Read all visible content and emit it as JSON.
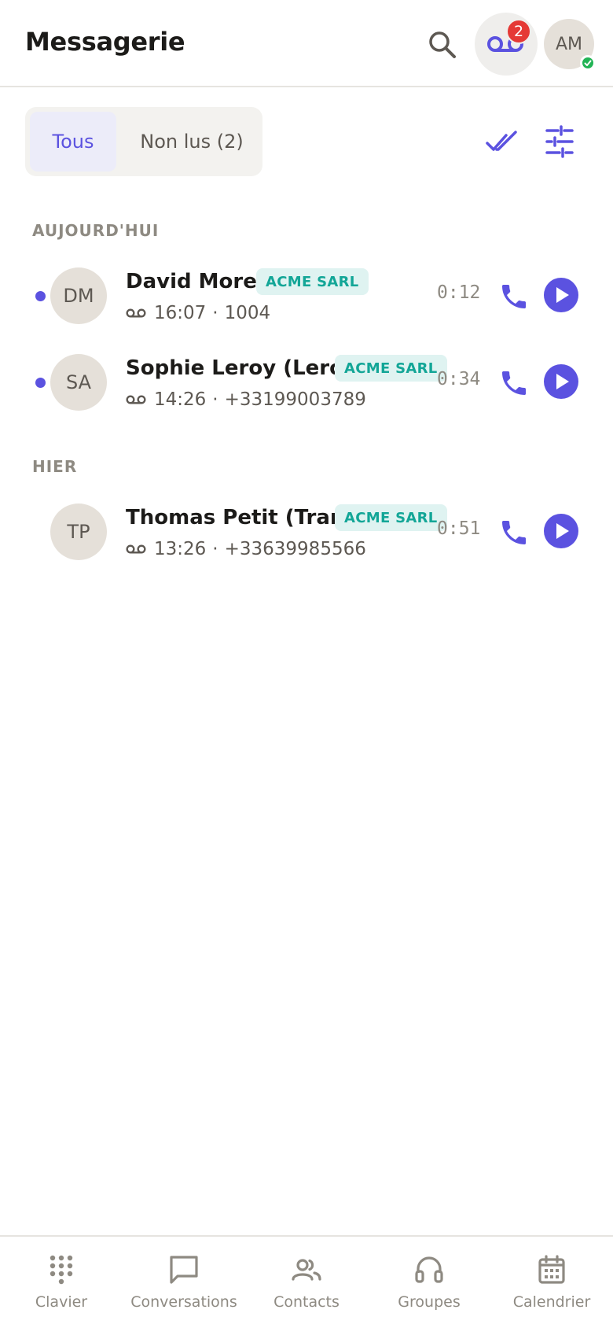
{
  "header": {
    "title": "Messagerie",
    "voicemail_badge": "2",
    "user_initials": "AM",
    "icons": [
      "search-icon",
      "voicemail-icon",
      "online-check-icon"
    ]
  },
  "filters": {
    "tabs": [
      {
        "label": "Tous",
        "selected": true
      },
      {
        "label": "Non lus (2)",
        "selected": false
      }
    ],
    "actions": [
      "mark-all-read-icon",
      "filter-settings-icon"
    ]
  },
  "sections": [
    {
      "label": "AUJOURD'HUI",
      "items": [
        {
          "initials": "DM",
          "name": "David Morel",
          "tag": "ACME SARL",
          "time": "16:07",
          "number": "1004",
          "duration": "0:12",
          "unread": true
        },
        {
          "initials": "SA",
          "name": "Sophie Leroy (Lero...",
          "tag": "ACME SARL",
          "time": "14:26",
          "number": "+33199003789",
          "duration": "0:34",
          "unread": true
        }
      ]
    },
    {
      "label": "HIER",
      "items": [
        {
          "initials": "TP",
          "name": "Thomas Petit (Tran...",
          "tag": "ACME SARL",
          "time": "13:26",
          "number": "+33639985566",
          "duration": "0:51",
          "unread": false
        }
      ]
    }
  ],
  "meta_separator": "·",
  "bottom_nav": [
    {
      "label": "Clavier",
      "icon": "dialpad-icon"
    },
    {
      "label": "Conversations",
      "icon": "chat-icon"
    },
    {
      "label": "Contacts",
      "icon": "contacts-icon"
    },
    {
      "label": "Groupes",
      "icon": "headset-icon"
    },
    {
      "label": "Calendrier",
      "icon": "calendar-icon"
    }
  ],
  "colors": {
    "accent": "#5b52e0",
    "tag_bg": "#dff3f1",
    "tag_text": "#13a697",
    "badge": "#e53935",
    "online": "#22b455"
  }
}
